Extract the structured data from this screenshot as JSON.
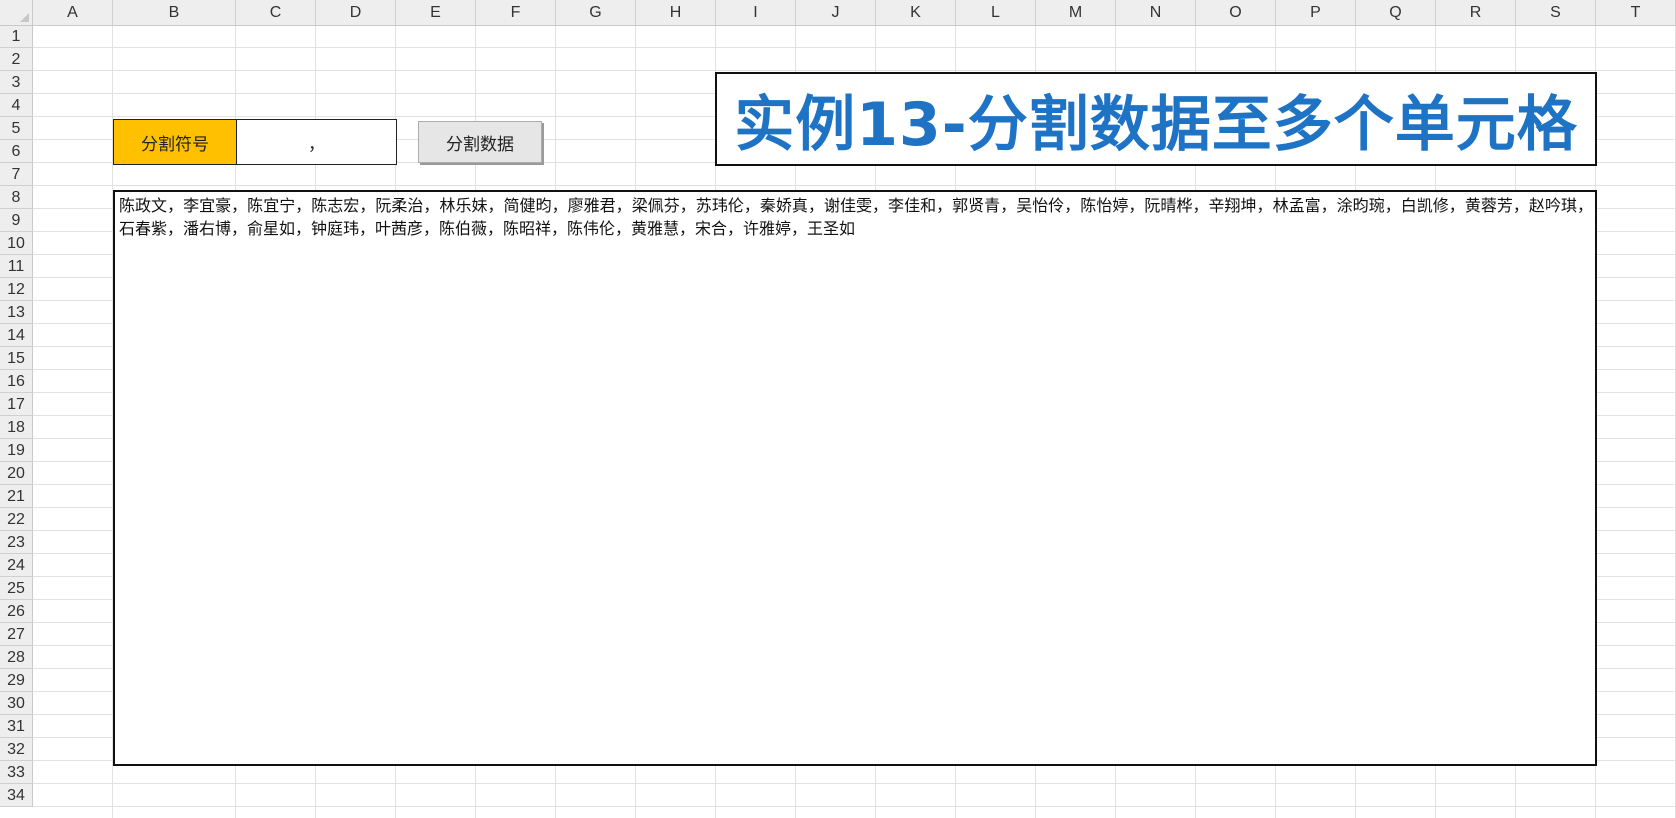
{
  "sheet": {
    "columns": [
      "A",
      "B",
      "C",
      "D",
      "E",
      "F",
      "G",
      "H",
      "I",
      "J",
      "K",
      "L",
      "M",
      "N",
      "O",
      "P",
      "Q",
      "R",
      "S",
      "T"
    ],
    "rows": [
      "1",
      "2",
      "3",
      "4",
      "5",
      "6",
      "7",
      "8",
      "9",
      "10",
      "11",
      "12",
      "13",
      "14",
      "15",
      "16",
      "17",
      "18",
      "19",
      "20",
      "21",
      "22",
      "23",
      "24",
      "25",
      "26",
      "27",
      "28",
      "29",
      "30",
      "31",
      "32",
      "33",
      "34"
    ]
  },
  "label_cell": {
    "text": "分割符号"
  },
  "separator_input": {
    "value": "，"
  },
  "split_button": {
    "label": "分割数据"
  },
  "title": {
    "text": "实例13-分割数据至多个单元格"
  },
  "data_box": {
    "text": "陈政文，李宜豪，陈宜宁，陈志宏，阮柔治，林乐妹，简健昀，廖雅君，梁佩芬，苏玮伦，秦娇真，谢佳雯，李佳和，郭贤青，吴怡伶，陈怡婷，阮晴桦，辛翔坤，林孟富，涂昀琬，白凯修，黄蓉芳，赵吟琪，石春紫，潘右博，俞星如，钟庭玮，叶茜彦，陈伯薇，陈昭祥，陈伟伦，黄雅慧，宋合，许雅婷，王圣如"
  }
}
